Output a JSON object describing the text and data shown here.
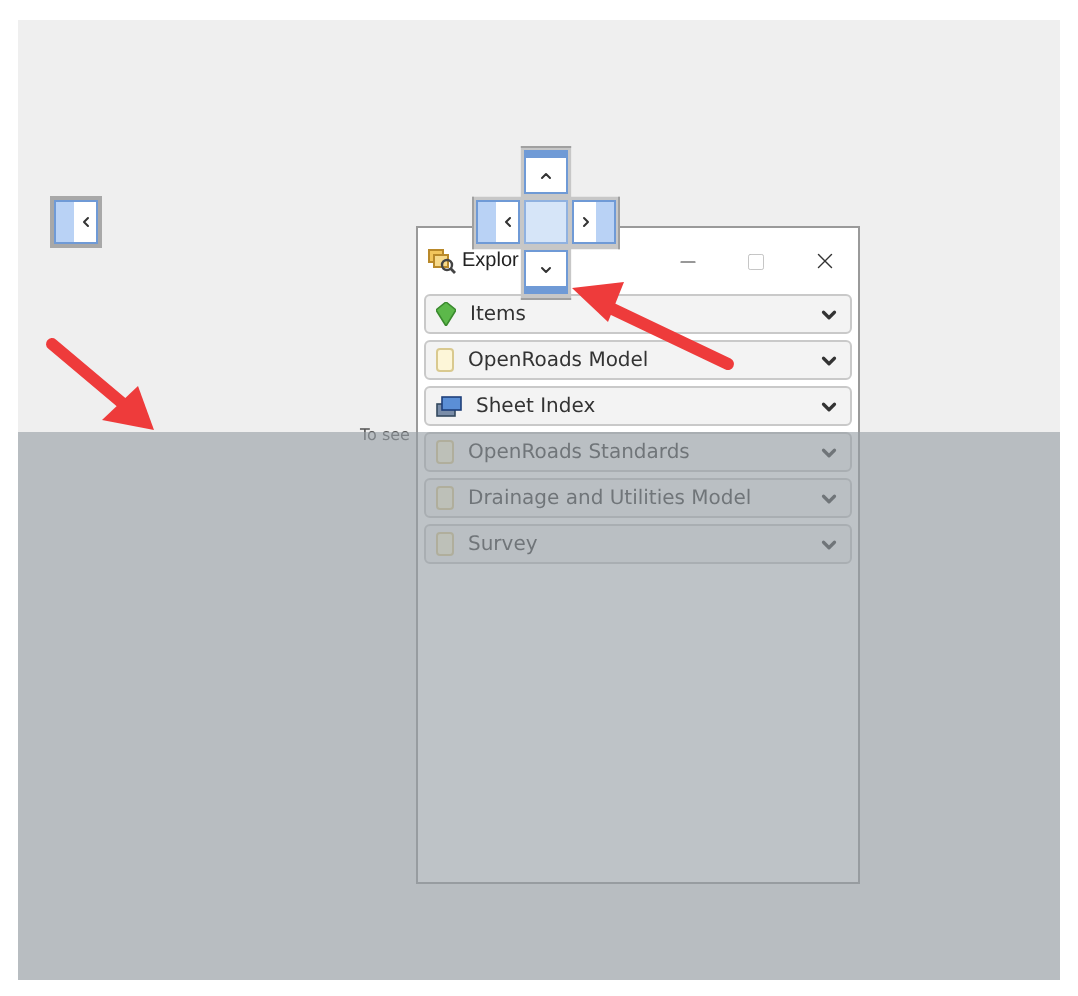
{
  "background_text": "To see",
  "window": {
    "title": "Explor"
  },
  "panels": [
    {
      "label": "Items",
      "kind": "items"
    },
    {
      "label": "OpenRoads Model",
      "kind": "file"
    },
    {
      "label": "Sheet Index",
      "kind": "sheets"
    },
    {
      "label": "OpenRoads Standards",
      "kind": "file"
    },
    {
      "label": "Drainage and Utilities Model",
      "kind": "file"
    },
    {
      "label": "Survey",
      "kind": "file"
    }
  ]
}
